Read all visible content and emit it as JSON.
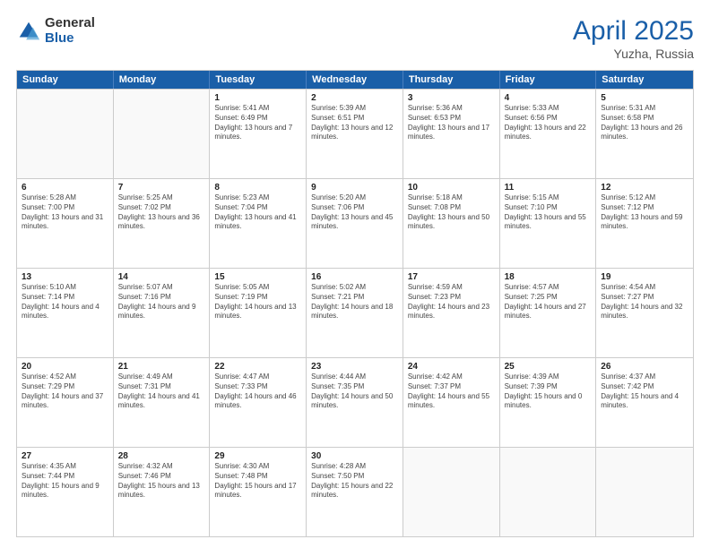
{
  "logo": {
    "general": "General",
    "blue": "Blue"
  },
  "title": {
    "month": "April 2025",
    "location": "Yuzha, Russia"
  },
  "days": [
    "Sunday",
    "Monday",
    "Tuesday",
    "Wednesday",
    "Thursday",
    "Friday",
    "Saturday"
  ],
  "weeks": [
    [
      {
        "date": "",
        "sunrise": "",
        "sunset": "",
        "daylight": ""
      },
      {
        "date": "",
        "sunrise": "",
        "sunset": "",
        "daylight": ""
      },
      {
        "date": "1",
        "sunrise": "Sunrise: 5:41 AM",
        "sunset": "Sunset: 6:49 PM",
        "daylight": "Daylight: 13 hours and 7 minutes."
      },
      {
        "date": "2",
        "sunrise": "Sunrise: 5:39 AM",
        "sunset": "Sunset: 6:51 PM",
        "daylight": "Daylight: 13 hours and 12 minutes."
      },
      {
        "date": "3",
        "sunrise": "Sunrise: 5:36 AM",
        "sunset": "Sunset: 6:53 PM",
        "daylight": "Daylight: 13 hours and 17 minutes."
      },
      {
        "date": "4",
        "sunrise": "Sunrise: 5:33 AM",
        "sunset": "Sunset: 6:56 PM",
        "daylight": "Daylight: 13 hours and 22 minutes."
      },
      {
        "date": "5",
        "sunrise": "Sunrise: 5:31 AM",
        "sunset": "Sunset: 6:58 PM",
        "daylight": "Daylight: 13 hours and 26 minutes."
      }
    ],
    [
      {
        "date": "6",
        "sunrise": "Sunrise: 5:28 AM",
        "sunset": "Sunset: 7:00 PM",
        "daylight": "Daylight: 13 hours and 31 minutes."
      },
      {
        "date": "7",
        "sunrise": "Sunrise: 5:25 AM",
        "sunset": "Sunset: 7:02 PM",
        "daylight": "Daylight: 13 hours and 36 minutes."
      },
      {
        "date": "8",
        "sunrise": "Sunrise: 5:23 AM",
        "sunset": "Sunset: 7:04 PM",
        "daylight": "Daylight: 13 hours and 41 minutes."
      },
      {
        "date": "9",
        "sunrise": "Sunrise: 5:20 AM",
        "sunset": "Sunset: 7:06 PM",
        "daylight": "Daylight: 13 hours and 45 minutes."
      },
      {
        "date": "10",
        "sunrise": "Sunrise: 5:18 AM",
        "sunset": "Sunset: 7:08 PM",
        "daylight": "Daylight: 13 hours and 50 minutes."
      },
      {
        "date": "11",
        "sunrise": "Sunrise: 5:15 AM",
        "sunset": "Sunset: 7:10 PM",
        "daylight": "Daylight: 13 hours and 55 minutes."
      },
      {
        "date": "12",
        "sunrise": "Sunrise: 5:12 AM",
        "sunset": "Sunset: 7:12 PM",
        "daylight": "Daylight: 13 hours and 59 minutes."
      }
    ],
    [
      {
        "date": "13",
        "sunrise": "Sunrise: 5:10 AM",
        "sunset": "Sunset: 7:14 PM",
        "daylight": "Daylight: 14 hours and 4 minutes."
      },
      {
        "date": "14",
        "sunrise": "Sunrise: 5:07 AM",
        "sunset": "Sunset: 7:16 PM",
        "daylight": "Daylight: 14 hours and 9 minutes."
      },
      {
        "date": "15",
        "sunrise": "Sunrise: 5:05 AM",
        "sunset": "Sunset: 7:19 PM",
        "daylight": "Daylight: 14 hours and 13 minutes."
      },
      {
        "date": "16",
        "sunrise": "Sunrise: 5:02 AM",
        "sunset": "Sunset: 7:21 PM",
        "daylight": "Daylight: 14 hours and 18 minutes."
      },
      {
        "date": "17",
        "sunrise": "Sunrise: 4:59 AM",
        "sunset": "Sunset: 7:23 PM",
        "daylight": "Daylight: 14 hours and 23 minutes."
      },
      {
        "date": "18",
        "sunrise": "Sunrise: 4:57 AM",
        "sunset": "Sunset: 7:25 PM",
        "daylight": "Daylight: 14 hours and 27 minutes."
      },
      {
        "date": "19",
        "sunrise": "Sunrise: 4:54 AM",
        "sunset": "Sunset: 7:27 PM",
        "daylight": "Daylight: 14 hours and 32 minutes."
      }
    ],
    [
      {
        "date": "20",
        "sunrise": "Sunrise: 4:52 AM",
        "sunset": "Sunset: 7:29 PM",
        "daylight": "Daylight: 14 hours and 37 minutes."
      },
      {
        "date": "21",
        "sunrise": "Sunrise: 4:49 AM",
        "sunset": "Sunset: 7:31 PM",
        "daylight": "Daylight: 14 hours and 41 minutes."
      },
      {
        "date": "22",
        "sunrise": "Sunrise: 4:47 AM",
        "sunset": "Sunset: 7:33 PM",
        "daylight": "Daylight: 14 hours and 46 minutes."
      },
      {
        "date": "23",
        "sunrise": "Sunrise: 4:44 AM",
        "sunset": "Sunset: 7:35 PM",
        "daylight": "Daylight: 14 hours and 50 minutes."
      },
      {
        "date": "24",
        "sunrise": "Sunrise: 4:42 AM",
        "sunset": "Sunset: 7:37 PM",
        "daylight": "Daylight: 14 hours and 55 minutes."
      },
      {
        "date": "25",
        "sunrise": "Sunrise: 4:39 AM",
        "sunset": "Sunset: 7:39 PM",
        "daylight": "Daylight: 15 hours and 0 minutes."
      },
      {
        "date": "26",
        "sunrise": "Sunrise: 4:37 AM",
        "sunset": "Sunset: 7:42 PM",
        "daylight": "Daylight: 15 hours and 4 minutes."
      }
    ],
    [
      {
        "date": "27",
        "sunrise": "Sunrise: 4:35 AM",
        "sunset": "Sunset: 7:44 PM",
        "daylight": "Daylight: 15 hours and 9 minutes."
      },
      {
        "date": "28",
        "sunrise": "Sunrise: 4:32 AM",
        "sunset": "Sunset: 7:46 PM",
        "daylight": "Daylight: 15 hours and 13 minutes."
      },
      {
        "date": "29",
        "sunrise": "Sunrise: 4:30 AM",
        "sunset": "Sunset: 7:48 PM",
        "daylight": "Daylight: 15 hours and 17 minutes."
      },
      {
        "date": "30",
        "sunrise": "Sunrise: 4:28 AM",
        "sunset": "Sunset: 7:50 PM",
        "daylight": "Daylight: 15 hours and 22 minutes."
      },
      {
        "date": "",
        "sunrise": "",
        "sunset": "",
        "daylight": ""
      },
      {
        "date": "",
        "sunrise": "",
        "sunset": "",
        "daylight": ""
      },
      {
        "date": "",
        "sunrise": "",
        "sunset": "",
        "daylight": ""
      }
    ]
  ]
}
